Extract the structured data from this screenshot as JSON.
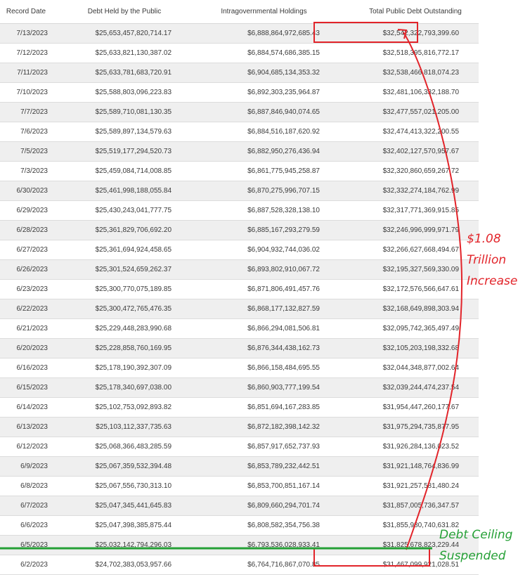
{
  "table": {
    "headers": [
      "Record Date",
      "Debt Held by the Public",
      "Intragovernmental Holdings",
      "Total Public Debt Outstanding"
    ],
    "rows": [
      [
        "7/13/2023",
        "$25,653,457,820,714.17",
        "$6,888,864,972,685.43",
        "$32,542,322,793,399.60"
      ],
      [
        "7/12/2023",
        "$25,633,821,130,387.02",
        "$6,884,574,686,385.15",
        "$32,518,395,816,772.17"
      ],
      [
        "7/11/2023",
        "$25,633,781,683,720.91",
        "$6,904,685,134,353.32",
        "$32,538,466,818,074.23"
      ],
      [
        "7/10/2023",
        "$25,588,803,096,223.83",
        "$6,892,303,235,964.87",
        "$32,481,106,332,188.70"
      ],
      [
        "7/7/2023",
        "$25,589,710,081,130.35",
        "$6,887,846,940,074.65",
        "$32,477,557,021,205.00"
      ],
      [
        "7/6/2023",
        "$25,589,897,134,579.63",
        "$6,884,516,187,620.92",
        "$32,474,413,322,200.55"
      ],
      [
        "7/5/2023",
        "$25,519,177,294,520.73",
        "$6,882,950,276,436.94",
        "$32,402,127,570,957.67"
      ],
      [
        "7/3/2023",
        "$25,459,084,714,008.85",
        "$6,861,775,945,258.87",
        "$32,320,860,659,267.72"
      ],
      [
        "6/30/2023",
        "$25,461,998,188,055.84",
        "$6,870,275,996,707.15",
        "$32,332,274,184,762.99"
      ],
      [
        "6/29/2023",
        "$25,430,243,041,777.75",
        "$6,887,528,328,138.10",
        "$32,317,771,369,915.85"
      ],
      [
        "6/28/2023",
        "$25,361,829,706,692.20",
        "$6,885,167,293,279.59",
        "$32,246,996,999,971.79"
      ],
      [
        "6/27/2023",
        "$25,361,694,924,458.65",
        "$6,904,932,744,036.02",
        "$32,266,627,668,494.67"
      ],
      [
        "6/26/2023",
        "$25,301,524,659,262.37",
        "$6,893,802,910,067.72",
        "$32,195,327,569,330.09"
      ],
      [
        "6/23/2023",
        "$25,300,770,075,189.85",
        "$6,871,806,491,457.76",
        "$32,172,576,566,647.61"
      ],
      [
        "6/22/2023",
        "$25,300,472,765,476.35",
        "$6,868,177,132,827.59",
        "$32,168,649,898,303.94"
      ],
      [
        "6/21/2023",
        "$25,229,448,283,990.68",
        "$6,866,294,081,506.81",
        "$32,095,742,365,497.49"
      ],
      [
        "6/20/2023",
        "$25,228,858,760,169.95",
        "$6,876,344,438,162.73",
        "$32,105,203,198,332.68"
      ],
      [
        "6/16/2023",
        "$25,178,190,392,307.09",
        "$6,866,158,484,695.55",
        "$32,044,348,877,002.64"
      ],
      [
        "6/15/2023",
        "$25,178,340,697,038.00",
        "$6,860,903,777,199.54",
        "$32,039,244,474,237.54"
      ],
      [
        "6/14/2023",
        "$25,102,753,092,893.82",
        "$6,851,694,167,283.85",
        "$31,954,447,260,177.67"
      ],
      [
        "6/13/2023",
        "$25,103,112,337,735.63",
        "$6,872,182,398,142.32",
        "$31,975,294,735,877.95"
      ],
      [
        "6/12/2023",
        "$25,068,366,483,285.59",
        "$6,857,917,652,737.93",
        "$31,926,284,136,023.52"
      ],
      [
        "6/9/2023",
        "$25,067,359,532,394.48",
        "$6,853,789,232,442.51",
        "$31,921,148,764,836.99"
      ],
      [
        "6/8/2023",
        "$25,067,556,730,313.10",
        "$6,853,700,851,167.14",
        "$31,921,257,581,480.24"
      ],
      [
        "6/7/2023",
        "$25,047,345,441,645.83",
        "$6,809,660,294,701.74",
        "$31,857,005,736,347.57"
      ],
      [
        "6/6/2023",
        "$25,047,398,385,875.44",
        "$6,808,582,354,756.38",
        "$31,855,980,740,631.82"
      ],
      [
        "6/5/2023",
        "$25,032,142,794,296.03",
        "$6,793,536,028,933.41",
        "$31,825,678,823,229.44"
      ],
      [
        "6/2/2023",
        "$24,702,383,053,957.66",
        "$6,764,716,867,070.85",
        "$31,467,099,921,028.51"
      ]
    ]
  },
  "annotations": {
    "increase": [
      "$1.08",
      "Trillion",
      "Increase"
    ],
    "ceiling": [
      "Debt Ceiling",
      "Suspended"
    ],
    "colors": {
      "red": "#e2242a",
      "green": "#25a036"
    }
  }
}
